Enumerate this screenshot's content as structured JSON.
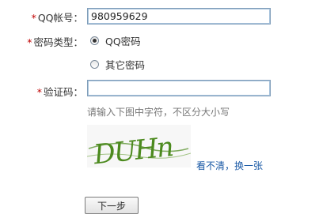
{
  "account": {
    "label": "QQ帐号：",
    "value": "980959629"
  },
  "password_type": {
    "label": "密码类型：",
    "options": [
      {
        "label": "QQ密码",
        "selected": true
      },
      {
        "label": "其它密码",
        "selected": false
      }
    ]
  },
  "verify": {
    "label": "验证码：",
    "value": "",
    "hint": "请输入下图中字符，不区分大小写",
    "captcha_text": "DUHn",
    "refresh_link_a": "看不清",
    "refresh_sep": "，",
    "refresh_link_b": "换一张"
  },
  "required_mark": "*",
  "next_button": "下一步",
  "colors": {
    "required": "#c00000",
    "link": "#1b5aa6",
    "captcha_ink": "#4c8a1e",
    "input_border": "#7f9db9"
  }
}
